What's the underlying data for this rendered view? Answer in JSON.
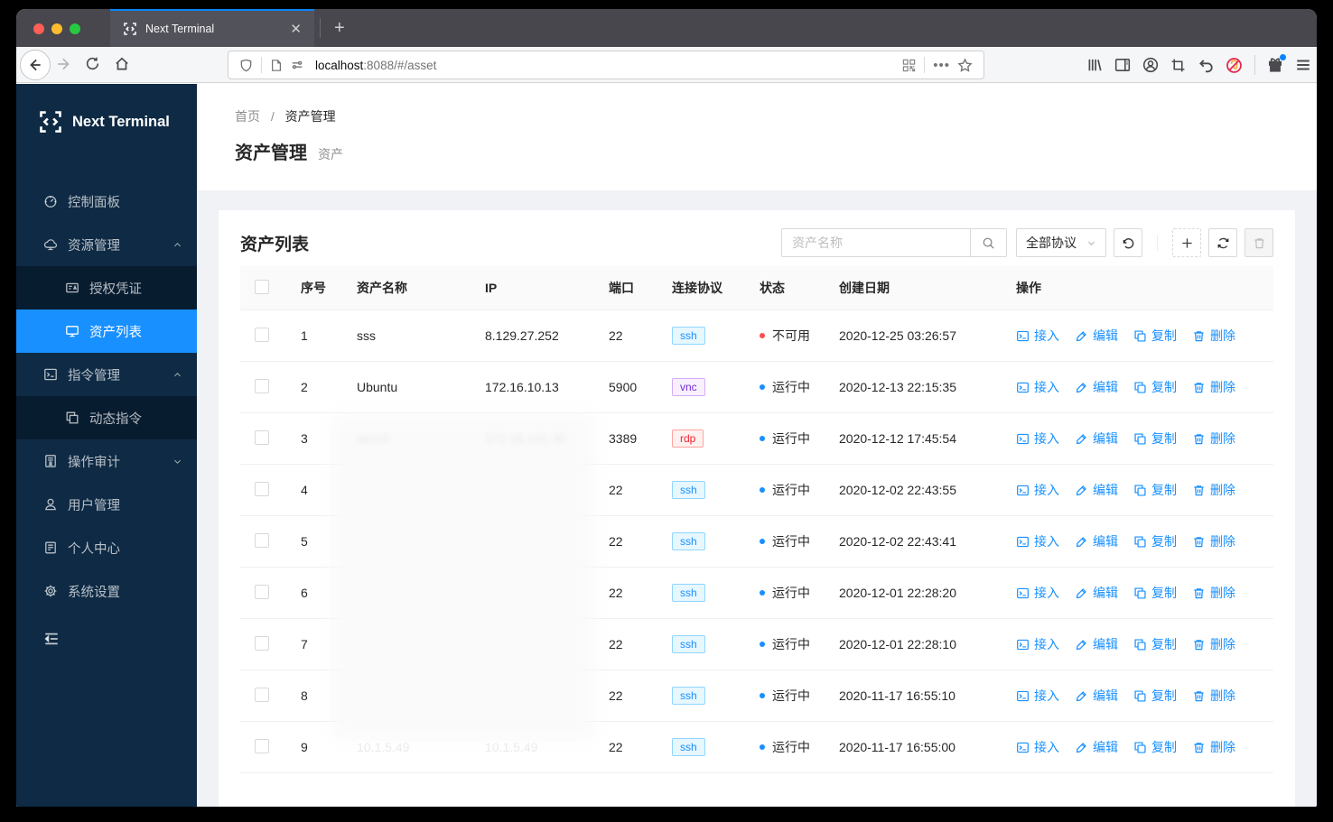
{
  "colors": {
    "accent": "#1890ff",
    "sidebar_bg": "#0e2a44",
    "sidebar_sub_bg": "#081c30",
    "status_running": "#1890ff",
    "status_unavailable": "#ff4d4f",
    "tab_accent": "#0a84ff"
  },
  "browser": {
    "tab_title": "Next Terminal",
    "close_tab_glyph": "✕",
    "new_tab_glyph": "+",
    "url_host": "localhost",
    "url_rest": ":8088/#/asset"
  },
  "sidebar": {
    "logo_text": "Next Terminal",
    "items": [
      {
        "label": "控制面板",
        "icon": "dashboard-icon",
        "kind": "item"
      },
      {
        "label": "资源管理",
        "icon": "cloud-server-icon",
        "kind": "group",
        "chevron": "up"
      },
      {
        "label": "授权凭证",
        "icon": "credential-icon",
        "kind": "sub"
      },
      {
        "label": "资产列表",
        "icon": "desktop-icon",
        "kind": "sub",
        "active": true
      },
      {
        "label": "指令管理",
        "icon": "code-icon",
        "kind": "group",
        "chevron": "up"
      },
      {
        "label": "动态指令",
        "icon": "block-icon",
        "kind": "sub"
      },
      {
        "label": "操作审计",
        "icon": "audit-icon",
        "kind": "group",
        "chevron": "down"
      },
      {
        "label": "用户管理",
        "icon": "user-icon",
        "kind": "item"
      },
      {
        "label": "个人中心",
        "icon": "profile-icon",
        "kind": "item"
      },
      {
        "label": "系统设置",
        "icon": "setting-icon",
        "kind": "item"
      }
    ]
  },
  "breadcrumb": {
    "home": "首页",
    "separator": "/",
    "current": "资产管理"
  },
  "page": {
    "title": "资产管理",
    "subtitle": "资产"
  },
  "card": {
    "title": "资产列表",
    "search_placeholder": "资产名称",
    "protocol_filter_value": "全部协议"
  },
  "table": {
    "headers": [
      "序号",
      "资产名称",
      "IP",
      "端口",
      "连接协议",
      "状态",
      "创建日期",
      "操作"
    ],
    "action_labels": {
      "access": "接入",
      "edit": "编辑",
      "copy": "复制",
      "delete": "删除"
    },
    "status_labels": {
      "running": "运行中",
      "unavailable": "不可用"
    },
    "rows": [
      {
        "no": "1",
        "name": "sss",
        "ip": "8.129.27.252",
        "port": "22",
        "protocol": "ssh",
        "status": "不可用",
        "status_type": "unavailable",
        "date": "2020-12-25 03:26:57",
        "redacted": false,
        "faint": false
      },
      {
        "no": "2",
        "name": "Ubuntu",
        "ip": "172.16.10.13",
        "port": "5900",
        "protocol": "vnc",
        "status": "运行中",
        "status_type": "running",
        "date": "2020-12-13 22:15:35",
        "redacted": false,
        "faint": false
      },
      {
        "no": "3",
        "name": "win10",
        "ip": "172.16.101.30",
        "port": "3389",
        "protocol": "rdp",
        "status": "运行中",
        "status_type": "running",
        "date": "2020-12-12 17:45:54",
        "redacted": false,
        "faint": false
      },
      {
        "no": "4",
        "name": "",
        "ip": "",
        "port": "22",
        "protocol": "ssh",
        "status": "运行中",
        "status_type": "running",
        "date": "2020-12-02 22:43:55",
        "redacted": true,
        "faint": false
      },
      {
        "no": "5",
        "name": "",
        "ip": "",
        "port": "22",
        "protocol": "ssh",
        "status": "运行中",
        "status_type": "running",
        "date": "2020-12-02 22:43:41",
        "redacted": true,
        "faint": false
      },
      {
        "no": "6",
        "name": "",
        "ip": "",
        "port": "22",
        "protocol": "ssh",
        "status": "运行中",
        "status_type": "running",
        "date": "2020-12-01 22:28:20",
        "redacted": true,
        "faint": false
      },
      {
        "no": "7",
        "name": "",
        "ip": "",
        "port": "22",
        "protocol": "ssh",
        "status": "运行中",
        "status_type": "running",
        "date": "2020-12-01 22:28:10",
        "redacted": true,
        "faint": false
      },
      {
        "no": "8",
        "name": "",
        "ip": "",
        "port": "22",
        "protocol": "ssh",
        "status": "运行中",
        "status_type": "running",
        "date": "2020-11-17 16:55:10",
        "redacted": true,
        "faint": false
      },
      {
        "no": "9",
        "name": "10.1.5.49",
        "ip": "10.1.5.49",
        "port": "22",
        "protocol": "ssh",
        "status": "运行中",
        "status_type": "running",
        "date": "2020-11-17 16:55:00",
        "redacted": true,
        "faint": true
      }
    ]
  }
}
